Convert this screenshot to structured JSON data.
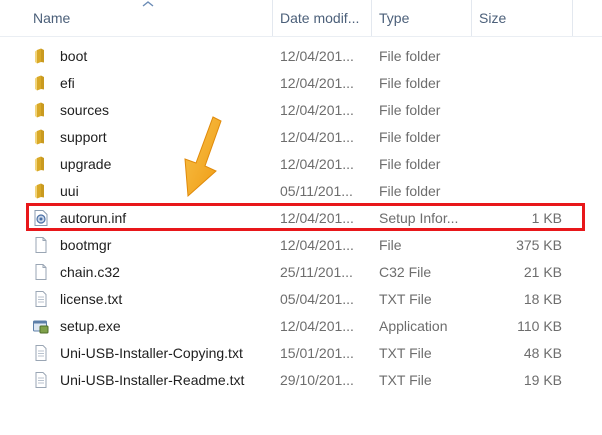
{
  "columns": {
    "name": "Name",
    "date": "Date modif...",
    "type": "Type",
    "size": "Size"
  },
  "files": [
    {
      "name": "boot",
      "date": "12/04/201...",
      "type": "File folder",
      "size": "",
      "icon": "folder-icon"
    },
    {
      "name": "efi",
      "date": "12/04/201...",
      "type": "File folder",
      "size": "",
      "icon": "folder-icon"
    },
    {
      "name": "sources",
      "date": "12/04/201...",
      "type": "File folder",
      "size": "",
      "icon": "folder-icon"
    },
    {
      "name": "support",
      "date": "12/04/201...",
      "type": "File folder",
      "size": "",
      "icon": "folder-icon"
    },
    {
      "name": "upgrade",
      "date": "12/04/201...",
      "type": "File folder",
      "size": "",
      "icon": "folder-icon"
    },
    {
      "name": "uui",
      "date": "05/11/201...",
      "type": "File folder",
      "size": "",
      "icon": "folder-icon"
    },
    {
      "name": "autorun.inf",
      "date": "12/04/201...",
      "type": "Setup Infor...",
      "size": "1 KB",
      "icon": "setup-info-icon"
    },
    {
      "name": "bootmgr",
      "date": "12/04/201...",
      "type": "File",
      "size": "375 KB",
      "icon": "file-icon"
    },
    {
      "name": "chain.c32",
      "date": "25/11/201...",
      "type": "C32 File",
      "size": "21 KB",
      "icon": "file-icon"
    },
    {
      "name": "license.txt",
      "date": "05/04/201...",
      "type": "TXT File",
      "size": "18 KB",
      "icon": "text-file-icon"
    },
    {
      "name": "setup.exe",
      "date": "12/04/201...",
      "type": "Application",
      "size": "110 KB",
      "icon": "application-icon"
    },
    {
      "name": "Uni-USB-Installer-Copying.txt",
      "date": "15/01/201...",
      "type": "TXT File",
      "size": "48 KB",
      "icon": "text-file-icon"
    },
    {
      "name": "Uni-USB-Installer-Readme.txt",
      "date": "29/10/201...",
      "type": "TXT File",
      "size": "19 KB",
      "icon": "text-file-icon"
    }
  ],
  "colors": {
    "highlight": "#e8171a",
    "arrow": "#f5a623",
    "folder": "#e8c35a"
  }
}
